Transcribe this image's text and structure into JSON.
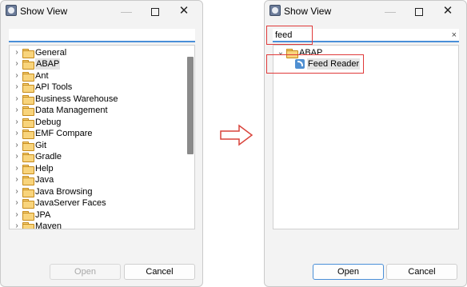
{
  "left_dialog": {
    "title": "Show View",
    "filter_value": "",
    "tree_items": [
      {
        "label": "General"
      },
      {
        "label": "ABAP",
        "selected": true
      },
      {
        "label": "Ant"
      },
      {
        "label": "API Tools"
      },
      {
        "label": "Business Warehouse"
      },
      {
        "label": "Data Management"
      },
      {
        "label": "Debug"
      },
      {
        "label": "EMF Compare"
      },
      {
        "label": "Git"
      },
      {
        "label": "Gradle"
      },
      {
        "label": "Help"
      },
      {
        "label": "Java"
      },
      {
        "label": "Java Browsing"
      },
      {
        "label": "JavaServer Faces"
      },
      {
        "label": "JPA"
      },
      {
        "label": "Maven"
      }
    ],
    "open_label": "Open",
    "cancel_label": "Cancel"
  },
  "right_dialog": {
    "title": "Show View",
    "filter_value": "feed",
    "clear_glyph": "×",
    "tree_items": [
      {
        "label": "ABAP",
        "expanded": true
      },
      {
        "label": "Feed Reader",
        "child": true,
        "selected": true
      }
    ],
    "open_label": "Open",
    "cancel_label": "Cancel"
  },
  "window_controls": {
    "minimize": "—",
    "close": "✕"
  },
  "colors": {
    "highlight": "#e03a3a",
    "focus": "#4a8fd8",
    "arrow": "#d9443c"
  }
}
